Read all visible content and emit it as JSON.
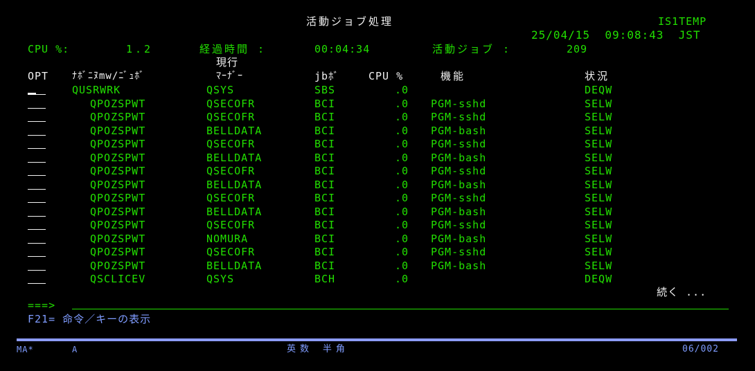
{
  "header": {
    "title": "活動ジョブ処理",
    "system": "IS1TEMP",
    "datetime": "25/04/15  09:08:43  JST"
  },
  "summary": {
    "cpu_label": "CPU %:",
    "cpu_value": "1.2",
    "elapsed_label": "経過時間 :",
    "elapsed_value": "00:04:34",
    "active_jobs_label": "活動ジョブ :",
    "active_jobs_value": "209"
  },
  "columns": {
    "opt": "OPT",
    "subsystem_job": "ﾅﾎﾞﾆﾇmw/ﾆﾞｭﾎﾞ",
    "current_label": "現行",
    "user": "ﾏｰﾅﾞｰ",
    "type": "jbﾎﾞ",
    "cpu": "CPU %",
    "function": "機能",
    "status": "状況"
  },
  "rows": [
    {
      "job": "QUSRWRK",
      "user": "QSYS",
      "type": "SBS",
      "cpu": ".0",
      "function": "",
      "status": "DEQW"
    },
    {
      "job": "QPOZSPWT",
      "user": "QSECOFR",
      "type": "BCI",
      "cpu": ".0",
      "function": "PGM-sshd",
      "status": "SELW"
    },
    {
      "job": "QPOZSPWT",
      "user": "QSECOFR",
      "type": "BCI",
      "cpu": ".0",
      "function": "PGM-sshd",
      "status": "SELW"
    },
    {
      "job": "QPOZSPWT",
      "user": "BELLDATA",
      "type": "BCI",
      "cpu": ".0",
      "function": "PGM-bash",
      "status": "SELW"
    },
    {
      "job": "QPOZSPWT",
      "user": "QSECOFR",
      "type": "BCI",
      "cpu": ".0",
      "function": "PGM-sshd",
      "status": "SELW"
    },
    {
      "job": "QPOZSPWT",
      "user": "BELLDATA",
      "type": "BCI",
      "cpu": ".0",
      "function": "PGM-bash",
      "status": "SELW"
    },
    {
      "job": "QPOZSPWT",
      "user": "QSECOFR",
      "type": "BCI",
      "cpu": ".0",
      "function": "PGM-sshd",
      "status": "SELW"
    },
    {
      "job": "QPOZSPWT",
      "user": "BELLDATA",
      "type": "BCI",
      "cpu": ".0",
      "function": "PGM-bash",
      "status": "SELW"
    },
    {
      "job": "QPOZSPWT",
      "user": "QSECOFR",
      "type": "BCI",
      "cpu": ".0",
      "function": "PGM-sshd",
      "status": "SELW"
    },
    {
      "job": "QPOZSPWT",
      "user": "BELLDATA",
      "type": "BCI",
      "cpu": ".0",
      "function": "PGM-bash",
      "status": "SELW"
    },
    {
      "job": "QPOZSPWT",
      "user": "QSECOFR",
      "type": "BCI",
      "cpu": ".0",
      "function": "PGM-sshd",
      "status": "SELW"
    },
    {
      "job": "QPOZSPWT",
      "user": "NOMURA",
      "type": "BCI",
      "cpu": ".0",
      "function": "PGM-bash",
      "status": "SELW"
    },
    {
      "job": "QPOZSPWT",
      "user": "QSECOFR",
      "type": "BCI",
      "cpu": ".0",
      "function": "PGM-sshd",
      "status": "SELW"
    },
    {
      "job": "QPOZSPWT",
      "user": "BELLDATA",
      "type": "BCI",
      "cpu": ".0",
      "function": "PGM-bash",
      "status": "SELW"
    },
    {
      "job": "QSCLICEV",
      "user": "QSYS",
      "type": "BCH",
      "cpu": ".0",
      "function": "",
      "status": "DEQW"
    }
  ],
  "more_label": "続く ...",
  "command": {
    "prompt": "===>",
    "value": ""
  },
  "fkeys": {
    "f21": "F21= 命令／キーの表示"
  },
  "status_bar": {
    "left1": "MA*",
    "left2": "A",
    "ime": "英数 半角",
    "position": "06/002"
  },
  "colors": {
    "background": "#000000",
    "field": "#22e000",
    "text": "#f2f2f2",
    "accent": "#7f9cff"
  }
}
